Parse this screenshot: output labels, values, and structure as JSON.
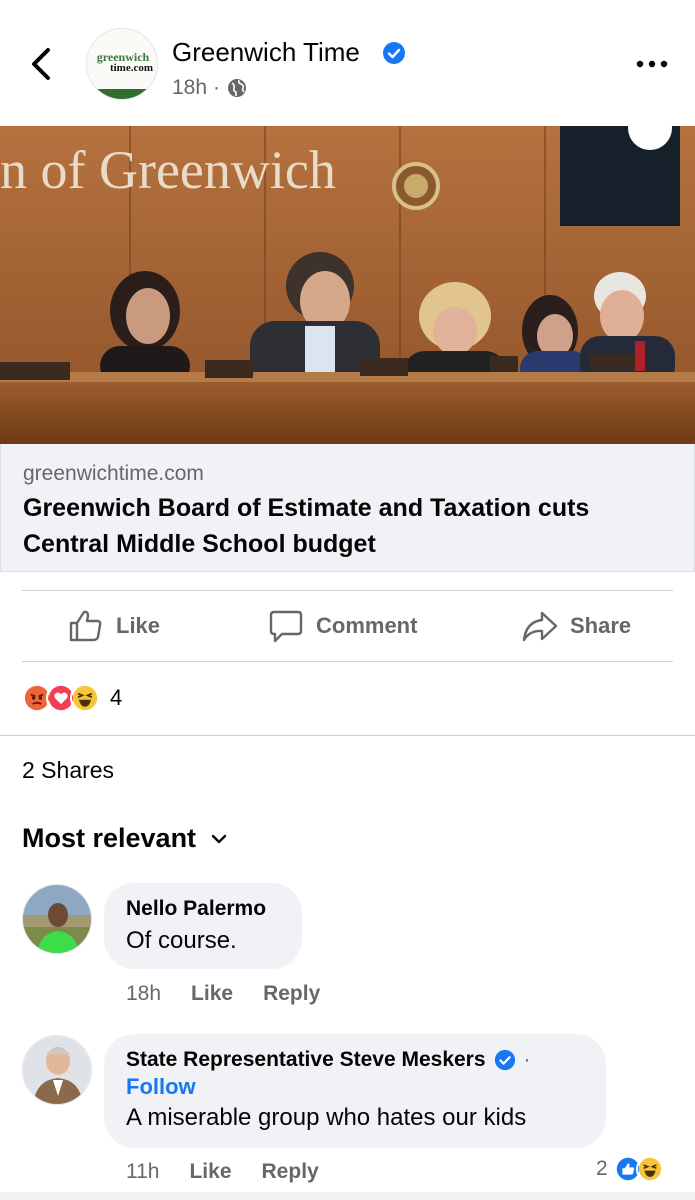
{
  "header": {
    "page_name": "Greenwich Time",
    "logo_line1": "greenwich",
    "logo_line2": "time.com",
    "time": "18h",
    "separator": "·"
  },
  "link": {
    "domain": "greenwichtime.com",
    "title": "Greenwich Board of Estimate and Taxation cuts Central Middle School budget",
    "photo_sign": "n of Greenwich"
  },
  "actions": {
    "like": "Like",
    "comment": "Comment",
    "share": "Share"
  },
  "reactions": {
    "count": "4",
    "types": [
      "angry-reaction",
      "love-reaction",
      "haha-reaction"
    ]
  },
  "shares": "2 Shares",
  "sort": "Most relevant",
  "comments": [
    {
      "name": "Nello Palermo",
      "text": "Of course.",
      "time": "18h",
      "like": "Like",
      "reply": "Reply"
    },
    {
      "name": "State Representative Steve Meskers",
      "follow": "Follow",
      "separator": "·",
      "text": "A miserable group who hates our kids",
      "time": "11h",
      "like": "Like",
      "reply": "Reply",
      "reaction_count": "2"
    }
  ],
  "colors": {
    "accent": "#1877f2",
    "secondary_text": "#65676b",
    "bubble": "#f0f2f5"
  }
}
